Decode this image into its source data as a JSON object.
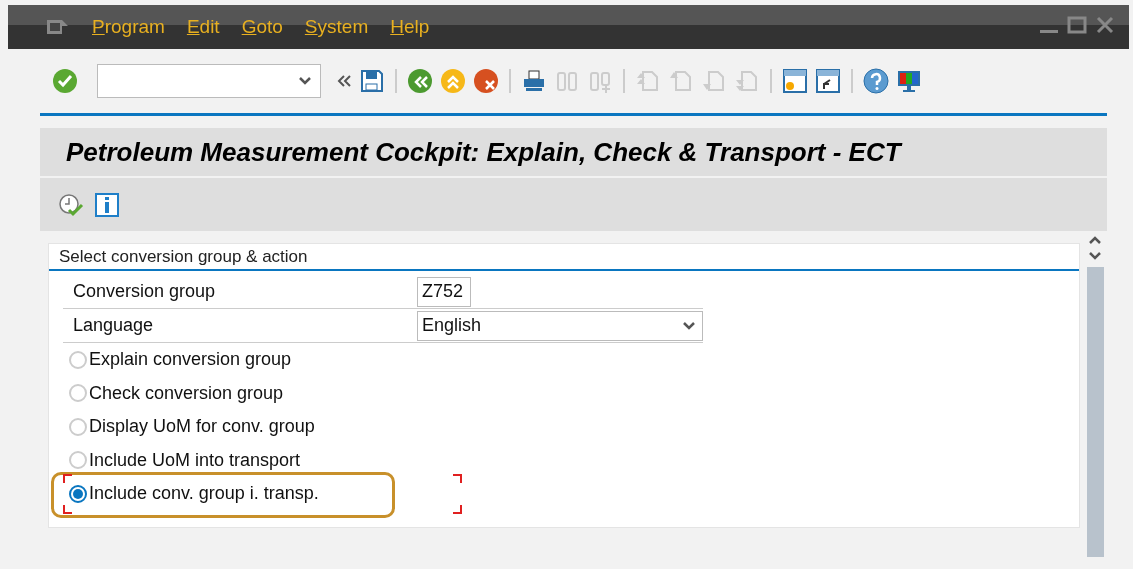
{
  "menu": [
    {
      "label": "Program"
    },
    {
      "label": "Edit"
    },
    {
      "label": "Goto"
    },
    {
      "label": "System"
    },
    {
      "label": "Help"
    }
  ],
  "title": "Petroleum Measurement Cockpit: Explain, Check & Transport - ECT",
  "panel": {
    "title": "Select conversion group & action",
    "fields": [
      {
        "label": "Conversion group",
        "value": "Z752",
        "kind": "input"
      },
      {
        "label": "Language",
        "value": "English",
        "kind": "select"
      }
    ],
    "options": [
      {
        "label": "Explain conversion group",
        "selected": false
      },
      {
        "label": "Check conversion group",
        "selected": false
      },
      {
        "label": "Display UoM for conv. group",
        "selected": false
      },
      {
        "label": "Include UoM into transport",
        "selected": false
      },
      {
        "label": "Include conv. group i. transp.",
        "selected": true
      }
    ]
  }
}
